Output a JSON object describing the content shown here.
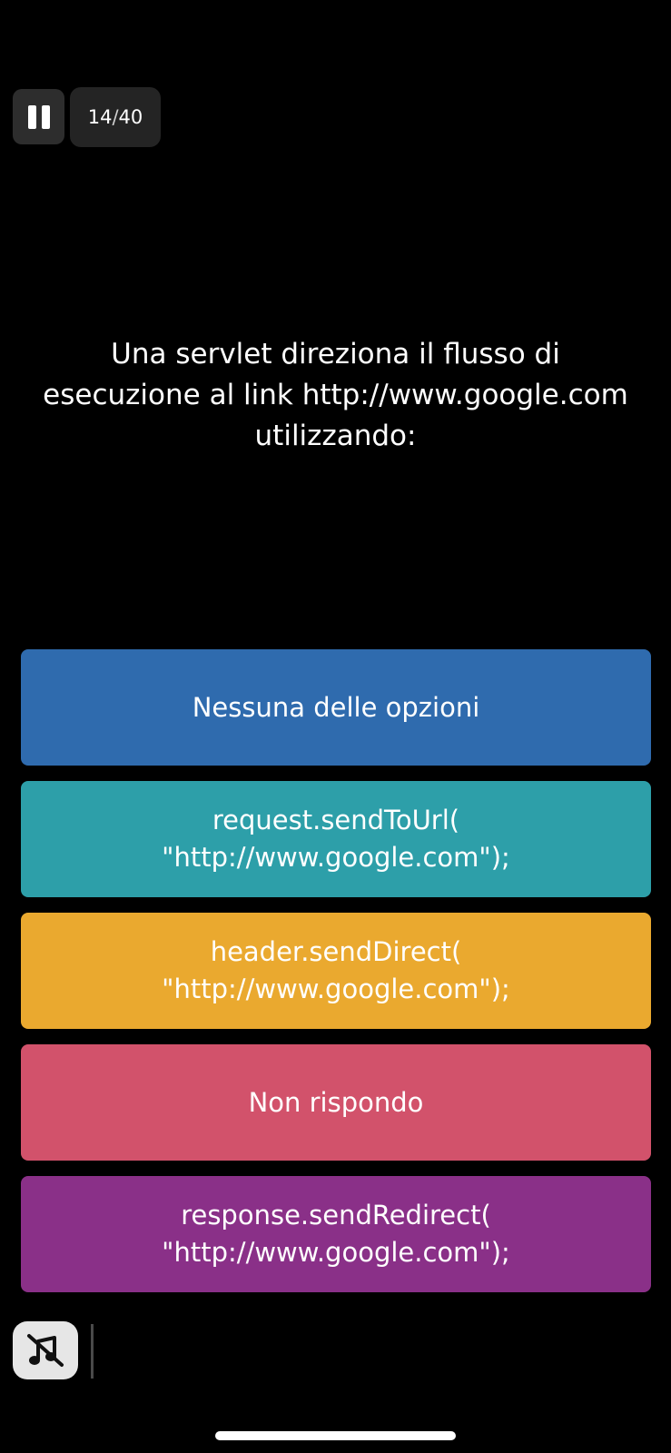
{
  "header": {
    "pause_icon": "pause-icon",
    "progress_current": "14",
    "progress_separator": "/",
    "progress_total": "40"
  },
  "question": {
    "text": "Una servlet direziona il flusso di esecuzione al link http://www.google.com utilizzando:"
  },
  "answers": [
    {
      "label": "Nessuna delle opzioni",
      "color": "#2f6bae"
    },
    {
      "label": "request.sendToUrl(\n\"http://www.google.com\");",
      "color": "#2d9fa9"
    },
    {
      "label": "header.sendDirect(\n\"http://www.google.com\");",
      "color": "#eaa92f"
    },
    {
      "label": "Non rispondo",
      "color": "#d2526b"
    },
    {
      "label": "response.sendRedirect(\n\"http://www.google.com\");",
      "color": "#8a3088"
    }
  ],
  "footer": {
    "mute_icon": "music-muted-icon"
  }
}
